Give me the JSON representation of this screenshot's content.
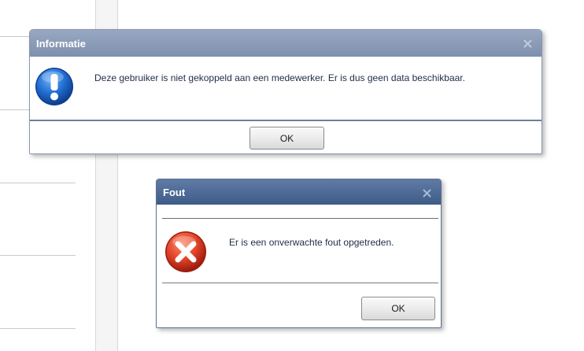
{
  "info_dialog": {
    "title": "Informatie",
    "icon": "info-icon",
    "close_icon": "close-icon",
    "message": "Deze gebruiker is niet gekoppeld aan een medewerker. Er is dus geen data beschikbaar.",
    "ok_label": "OK",
    "colors": {
      "header": "#8a9bb8",
      "border": "#8896ad",
      "icon": "#1f6fd0"
    }
  },
  "error_dialog": {
    "title": "Fout",
    "icon": "error-icon",
    "close_icon": "close-icon",
    "message": "Er is een onverwachte fout opgetreden.",
    "ok_label": "OK",
    "colors": {
      "header": "#4e6b97",
      "border": "#5b7193",
      "icon": "#d9381e"
    }
  }
}
